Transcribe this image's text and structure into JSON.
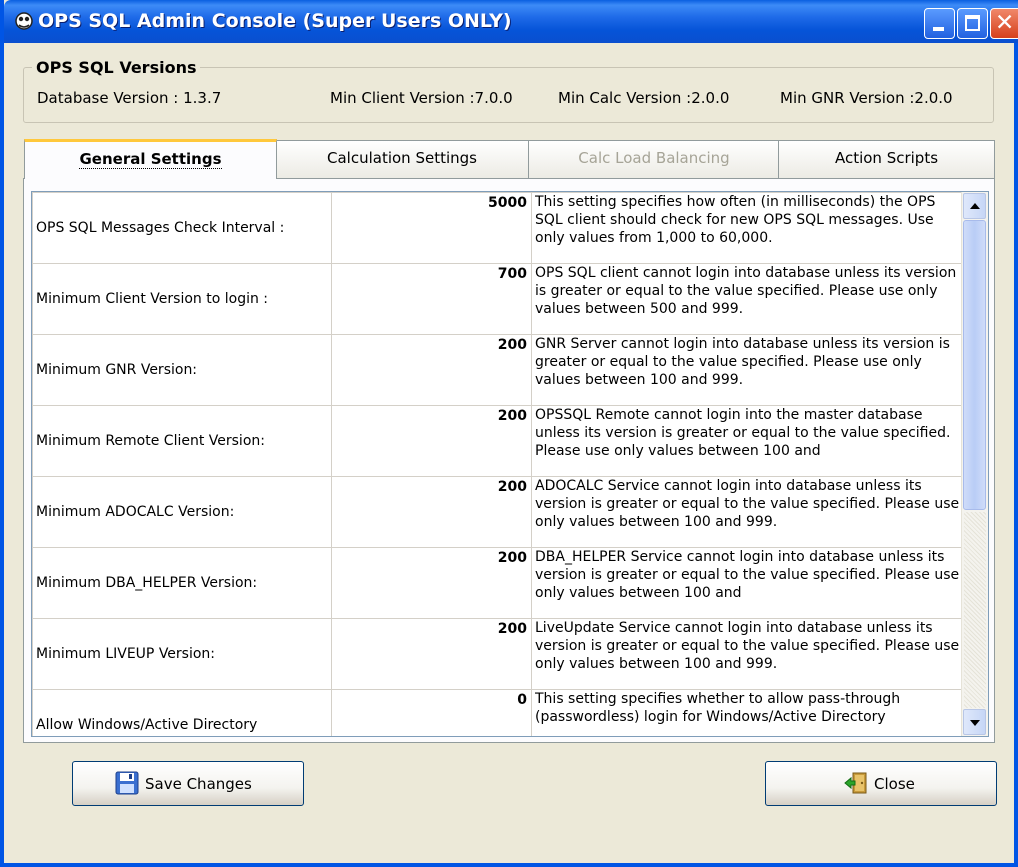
{
  "window": {
    "title": "OPS SQL Admin Console (Super Users ONLY)"
  },
  "versions": {
    "legend": "OPS SQL Versions",
    "database": "Database Version : 1.3.7",
    "min_client": "Min Client Version :7.0.0",
    "min_calc": "Min Calc Version :2.0.0",
    "min_gnr": "Min GNR Version :2.0.0"
  },
  "tabs": [
    {
      "label": "General Settings",
      "state": "active"
    },
    {
      "label": "Calculation Settings",
      "state": "normal"
    },
    {
      "label": "Calc Load Balancing",
      "state": "disabled"
    },
    {
      "label": "Action Scripts",
      "state": "normal"
    }
  ],
  "settings": [
    {
      "name": "OPS SQL Messages Check Interval :",
      "value": "5000",
      "description": "This setting specifies how often (in milliseconds) the OPS SQL client should check for new OPS SQL messages. Use only values from 1,000 to 60,000."
    },
    {
      "name": "Minimum Client Version to login :",
      "value": "700",
      "description": "OPS SQL client cannot login into database unless its version is greater or equal to the value specified. Please use only values between 500 and 999."
    },
    {
      "name": "Minimum GNR Version:",
      "value": "200",
      "description": "GNR Server cannot login into database unless its version is greater or equal to the value specified. Please use only values between 100 and 999."
    },
    {
      "name": "Minimum Remote Client Version:",
      "value": "200",
      "description": "OPSSQL Remote cannot login into the master database unless its version is greater or equal to the value specified. Please use only values between 100 and"
    },
    {
      "name": "Minimum ADOCALC Version:",
      "value": "200",
      "description": "ADOCALC Service cannot login into database unless its version is greater or equal to the value specified. Please use only values between 100 and 999."
    },
    {
      "name": "Minimum DBA_HELPER Version:",
      "value": "200",
      "description": "DBA_HELPER Service cannot login into database unless its version is greater or equal to the value specified. Please use only values between 100 and"
    },
    {
      "name": "Minimum LIVEUP Version:",
      "value": "200",
      "description": "LiveUpdate Service cannot login into database unless its version is greater or equal to the value specified. Please use only values between 100 and 999."
    },
    {
      "name": "Allow Windows/Active Directory",
      "value": "0",
      "description": "This setting specifies whether to allow pass-through (passwordless) login for Windows/Active Directory"
    }
  ],
  "buttons": {
    "save": "Save Changes",
    "close": "Close"
  },
  "colors": {
    "titlebar": "#0a4fcf",
    "window_bg": "#ece9d8",
    "active_tab_accent": "#ffc83c"
  },
  "icons": {
    "title": "app-icon",
    "save": "floppy-disk-icon",
    "close": "exit-door-icon"
  }
}
